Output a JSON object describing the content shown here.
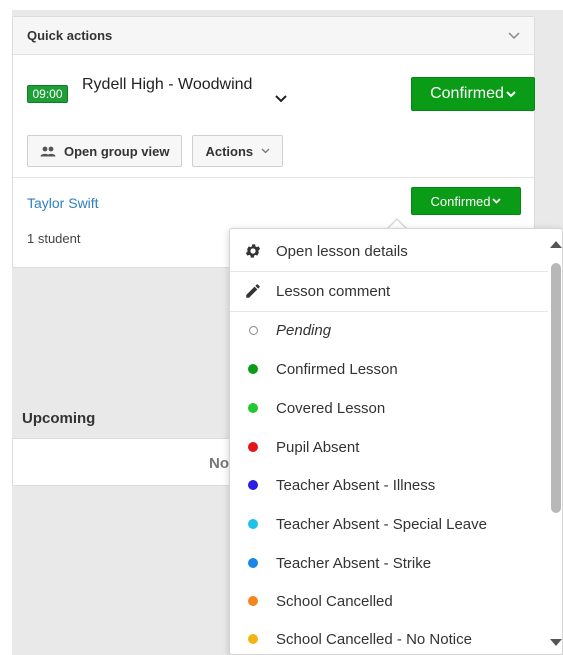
{
  "quick_actions": {
    "title": "Quick actions",
    "lesson": {
      "time": "09:00",
      "title": "Rydell High - Woodwind",
      "status_label": "Confirmed"
    },
    "buttons": {
      "group_view": "Open group view",
      "actions": "Actions"
    },
    "student": {
      "name": "Taylor Swift",
      "count": "1 student",
      "status_label": "Confirmed"
    }
  },
  "upcoming": {
    "title": "Upcoming",
    "placeholder": "No"
  },
  "dropdown": {
    "items": [
      {
        "label": "Open lesson details",
        "icon": "gear-icon"
      },
      {
        "label": "Lesson comment",
        "icon": "pencil-icon"
      },
      {
        "label": "Pending",
        "color": "#ffffff"
      },
      {
        "label": "Confirmed Lesson",
        "color": "#0a9b17"
      },
      {
        "label": "Covered Lesson",
        "color": "#22c732"
      },
      {
        "label": "Pupil Absent",
        "color": "#e5141b"
      },
      {
        "label": "Teacher Absent - Illness",
        "color": "#2a1de0"
      },
      {
        "label": "Teacher Absent - Special Leave",
        "color": "#1fc1e8"
      },
      {
        "label": "Teacher Absent - Strike",
        "color": "#1a86ea"
      },
      {
        "label": "School Cancelled",
        "color": "#f4861f"
      },
      {
        "label": "School Cancelled - No Notice",
        "color": "#f2b512"
      }
    ]
  },
  "colors": {
    "confirmed_green": "#0a9b17",
    "link_blue": "#2f7fc1"
  }
}
